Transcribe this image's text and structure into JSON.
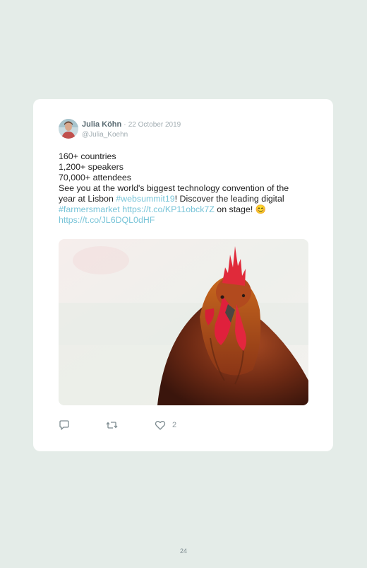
{
  "tweet": {
    "author_name": "Julia Köhn",
    "separator": "·",
    "date": "22 October 2019",
    "handle": "@Julia_Koehn",
    "lines": [
      "160+ countries",
      "1,200+ speakers",
      "70,000+ attendees",
      "See you at the world's biggest technology convention of the"
    ],
    "line5_text": "year at Lisbon ",
    "line5_link": "#websummit19",
    "line5_rest": "! Discover the leading digital",
    "line6_link1": "#farmersmarket",
    "line6_space": " ",
    "line6_link2": "https://t.co/KP11obck7Z",
    "line6_rest": " on stage! ",
    "line6_emoji": "😊",
    "line7_link": "https://t.co/JL6DQL0dHF"
  },
  "actions": {
    "reply_icon": "reply-icon",
    "retweet_icon": "retweet-icon",
    "like_icon": "heart-icon",
    "like_count": "2"
  },
  "page": {
    "number": "24"
  },
  "colors": {
    "background": "#e4ece8",
    "card": "#ffffff",
    "link": "#78c4d8",
    "author": "#5a6b72",
    "muted": "#a2adb2"
  }
}
